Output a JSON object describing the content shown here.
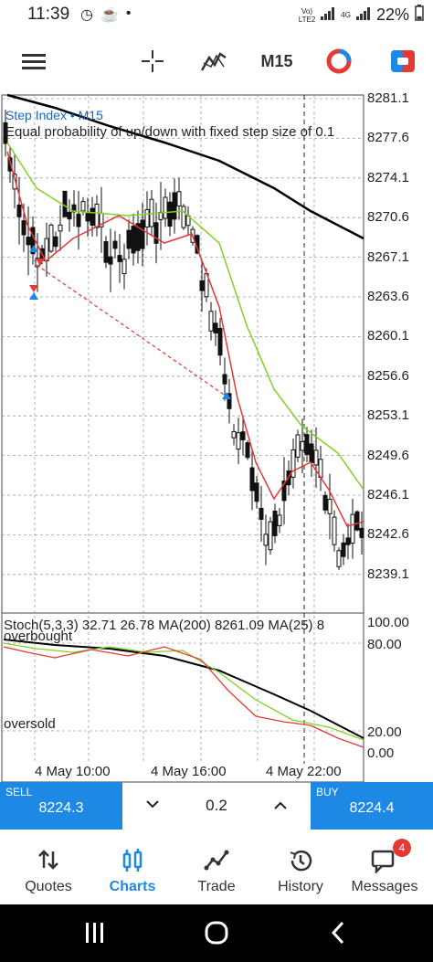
{
  "status_bar": {
    "time": "11:39",
    "battery": "22%",
    "network_top": "Vo)",
    "network_bottom": "LTE2",
    "signal_label": "4G"
  },
  "toolbar": {
    "timeframe": "M15"
  },
  "chart": {
    "symbol_label": "Step Index • M15",
    "description": "Equal probability of up/down with fixed step size of 0.1",
    "price_ticks": [
      "8281.1",
      "8277.6",
      "8274.1",
      "8270.6",
      "8267.1",
      "8263.6",
      "8260.1",
      "8256.6",
      "8253.1",
      "8249.6",
      "8246.1",
      "8242.6",
      "8239.1"
    ],
    "time_labels": [
      "4 May 10:00",
      "4 May 16:00",
      "4 May 22:00"
    ],
    "colors": {
      "ma_black": "#000000",
      "ma_green": "#7ed321",
      "ma_red": "#e53935",
      "grid": "#9e9e9e",
      "candle": "#111111",
      "arrow_buy": "#1e88e5",
      "arrow_sell": "#e53935"
    }
  },
  "stochastic": {
    "title": "Stoch(5,3,3) 32.71 26.78 MA(200) 8261.09 MA(25) 8",
    "overbought_label": "overbought",
    "oversold_label": "oversold",
    "ticks": [
      "100.00",
      "80.00",
      "20.00",
      "0.00"
    ]
  },
  "trade_bar": {
    "sell_caption": "SELL",
    "sell_price": "8224.3",
    "volume": "0.2",
    "buy_caption": "BUY",
    "buy_price": "8224.4"
  },
  "nav": {
    "quotes": "Quotes",
    "charts": "Charts",
    "trade": "Trade",
    "history": "History",
    "messages": "Messages",
    "messages_badge": "4"
  }
}
